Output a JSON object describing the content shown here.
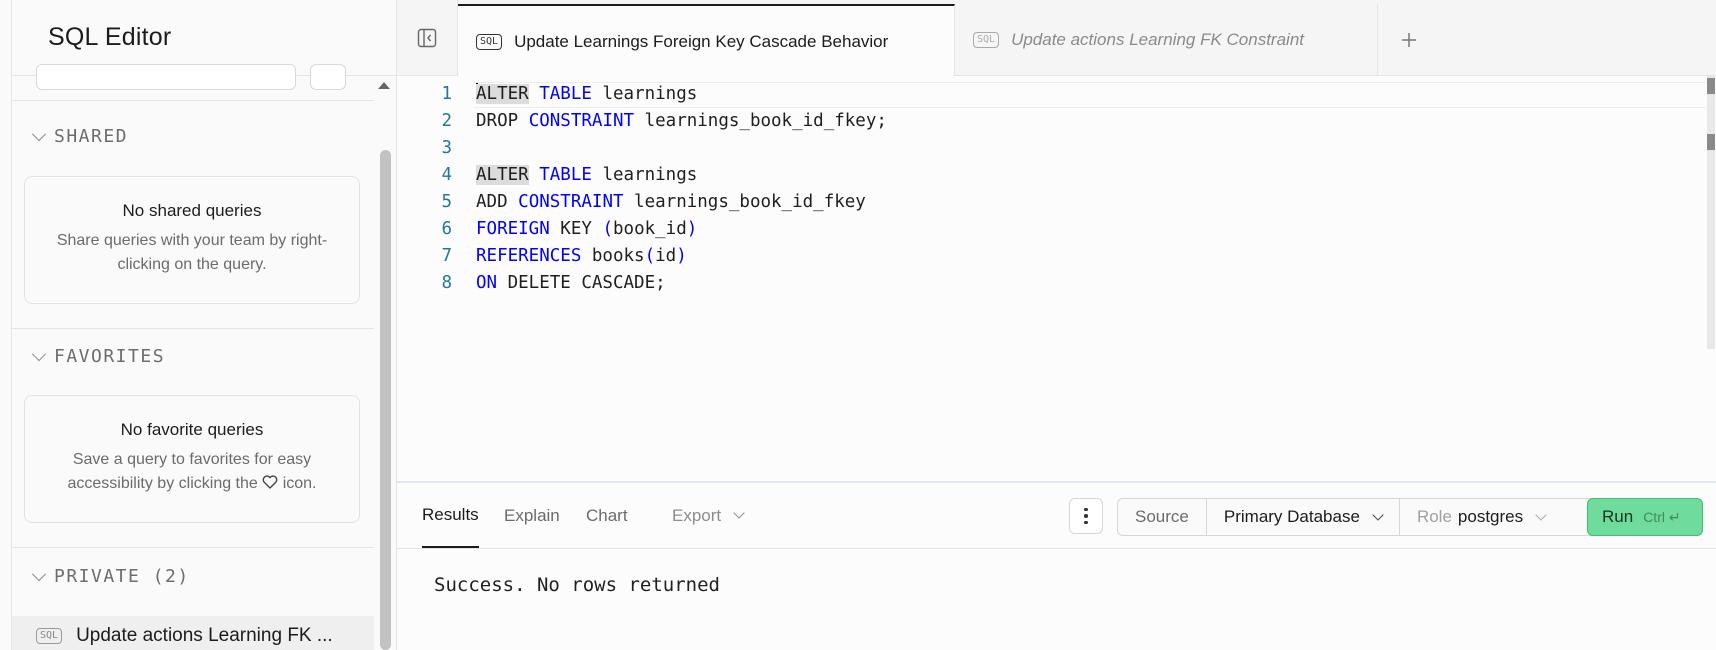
{
  "sidebar": {
    "title": "SQL Editor",
    "sections": {
      "shared": {
        "label": "SHARED",
        "empty_title": "No shared queries",
        "empty_desc": "Share queries with your team by right-clicking on the query."
      },
      "favorites": {
        "label": "FAVORITES",
        "empty_title": "No favorite queries",
        "empty_desc_before": "Save a query to favorites for easy accessibility by clicking the",
        "empty_desc_after": "icon."
      },
      "private": {
        "label": "PRIVATE (2)",
        "items": [
          {
            "badge": "SQL",
            "label": "Update actions Learning FK ..."
          }
        ]
      }
    }
  },
  "tabs": [
    {
      "badge": "SQL",
      "label": "Update Learnings Foreign Key Cascade Behavior",
      "active": true
    },
    {
      "badge": "SQL",
      "label": "Update actions Learning FK Constraint",
      "active": false
    }
  ],
  "editor": {
    "line_numbers": [
      "1",
      "2",
      "3",
      "4",
      "5",
      "6",
      "7",
      "8"
    ]
  },
  "results": {
    "tabs": {
      "results": "Results",
      "explain": "Explain",
      "chart": "Chart",
      "export": "Export"
    },
    "source_label": "Source",
    "database": "Primary Database",
    "role_key": "Role",
    "role_value": "postgres",
    "run_label": "Run",
    "run_hint": "Ctrl ↵",
    "message": "Success. No rows returned"
  },
  "colors": {
    "run_button": "#6fdc9c",
    "keyword": "#0000ff",
    "line_number": "#237893"
  }
}
